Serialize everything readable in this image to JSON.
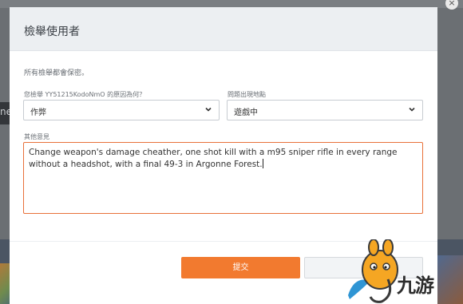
{
  "dialog": {
    "title": "檢舉使用者",
    "note": "所有檢舉都會保密。",
    "reason": {
      "label": "您檢舉 YY51215KodoNmO 的原因為何？",
      "value": "作弊"
    },
    "where": {
      "label": "問題出現地點",
      "value": "遊戲中"
    },
    "comment": {
      "label": "其他意見",
      "value": "Change weapon's damage cheather, one shot kill with a m95 sniper rifle in every range without a headshot, with a final 49-3 in Argonne Forest."
    },
    "submit_label": "提交",
    "cancel_label": ""
  },
  "background": {
    "side_text": "ne"
  },
  "watermark": {
    "text": "九游"
  },
  "colors": {
    "accent": "#f27a2f",
    "focus_border": "#e8713a"
  }
}
